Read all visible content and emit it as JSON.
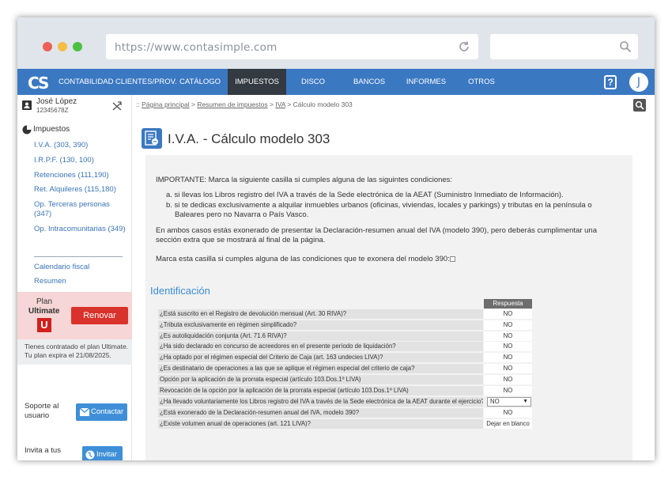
{
  "browser": {
    "url": "https://www.contasimple.com",
    "search_placeholder": ""
  },
  "nav": {
    "logo": "CS",
    "items": [
      "CONTABILIDAD",
      "CLIENTES/PROV.",
      "CATÁLOGO",
      "IMPUESTOS",
      "DISCO VIRTUAL",
      "BANCOS",
      "INFORMES",
      "OTROS"
    ],
    "help_label": "?",
    "avatar_initial": "J"
  },
  "user": {
    "name": "José López",
    "id": "12345678Z"
  },
  "sidebar": {
    "section": "Impuestos",
    "links": [
      "I.V.A. (303, 390)",
      "I.R.P.F. (130, 100)",
      "Retenciones (111,190)",
      "Ret. Alquileres (115,180)",
      "Op. Terceras personas (347)",
      "Op. Intracomunitarias (349)"
    ],
    "links2": [
      "Calendario fiscal",
      "Resumen"
    ]
  },
  "plan": {
    "label": "Plan",
    "name": "Ultimate",
    "badge": "U",
    "renew": "Renovar",
    "info_line1": "Tienes contratado el plan Ultimate.",
    "info_line2": "Tu plan expira el 21/08/2025."
  },
  "support": {
    "label1": "Soporte al",
    "label2": "usuario",
    "contact": "Contactar",
    "invite1": "Invita a tus",
    "invite": "Invitar"
  },
  "breadcrumb": {
    "prefix": "::",
    "home": "Página principal",
    "sep": ">",
    "summary": "Resumen de impuestos",
    "iva": "IVA",
    "current": "Cálculo modelo 303"
  },
  "page": {
    "title": "I.V.A. - Cálculo modelo 303"
  },
  "notice": {
    "important": "IMPORTANTE: Marca la siguiente casilla si cumples alguna de las siguintes condiciones:",
    "a": "a. si llevas los Libros registro del IVA a través de la Sede electrónica de la AEAT (Suministro Inmediato de Información).",
    "b1": "b. si te dedicas exclusivamente a alquilar inmuebles urbanos (oficinas, viviendas, locales y parkings) y tributas en la península o",
    "b2": "Baleares pero no Navarra o País Vasco.",
    "p1": "En ambos casos estás exonerado de presentar la Declaración-resumen anual del IVA (modelo 390), pero deberás cumplimentar una",
    "p2": "sección extra que se mostrará al final de la página.",
    "checkbox_label": "Marca esta casilla si cumples alguna de las condiciones que te exonera del modelo 390:"
  },
  "identificacion": {
    "heading": "Identificación",
    "answer_header": "Respuesta",
    "rows": [
      {
        "q": "¿Está suscrito en el Registro de devolución mensual (Art. 30 RIVA)?",
        "a": "NO"
      },
      {
        "q": "¿Tributa exclusivamente en régimen simplificado?",
        "a": "NO"
      },
      {
        "q": "¿Es autoliquidación conjunta (Art. 71.6 RIVA)?",
        "a": "NO"
      },
      {
        "q": "¿Ha sido declarado en concurso de acreedores en el presente período de liquidación?",
        "a": "NO"
      },
      {
        "q": "¿Ha optado por el régimen especial del Criterio de Caja (art. 163 undecies LIVA)?",
        "a": "NO"
      },
      {
        "q": "¿Es destinatario de operaciones a las que se aplique el régimen especial del criterio de caja?",
        "a": "NO"
      },
      {
        "q": "Opción por la aplicación de la prorrata especial (artículo 103.Dos.1º LIVA)",
        "a": "NO"
      },
      {
        "q": "Revocación de la opción por la aplicación de la prorrata especial (artículo 103.Dos.1º LIVA)",
        "a": "NO"
      },
      {
        "q": "¿Ha llevado voluntariamente los Libros registro del IVA a través de la Sede electrónica de la AEAT durante el ejercicio?",
        "a": "NO"
      },
      {
        "q": "¿Está exonerado de la Declaración-resumen anual del IVA, modelo 390?",
        "a": "NO"
      },
      {
        "q": "¿Existe volumen anual de operaciones (art. 121 LIVA)?",
        "a": "Dejar en blanco"
      }
    ]
  }
}
